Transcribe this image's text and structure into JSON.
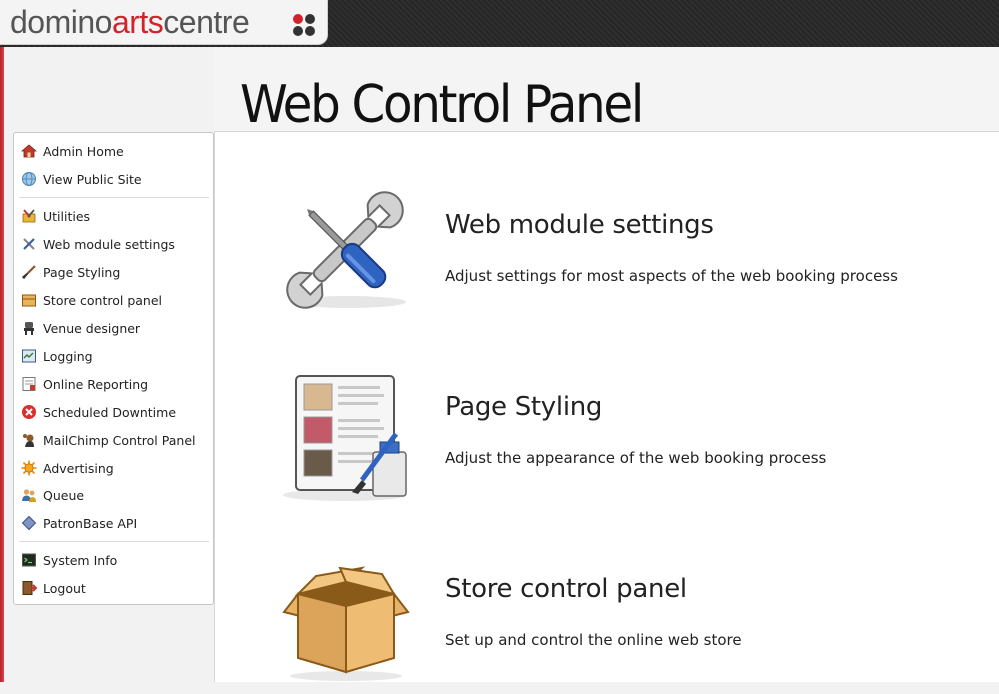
{
  "brand": {
    "part1": "domino",
    "part2": "arts",
    "part3": "centre"
  },
  "page": {
    "title": "Web Control Panel"
  },
  "sidebar": {
    "group1": [
      {
        "label": "Admin Home",
        "icon": "home-icon"
      },
      {
        "label": "View Public Site",
        "icon": "globe-icon"
      }
    ],
    "group2": [
      {
        "label": "Utilities",
        "icon": "utilities-icon"
      },
      {
        "label": "Web module settings",
        "icon": "tools-icon"
      },
      {
        "label": "Page Styling",
        "icon": "paintbrush-icon"
      },
      {
        "label": "Store control panel",
        "icon": "box-icon"
      },
      {
        "label": "Venue designer",
        "icon": "seat-icon"
      },
      {
        "label": "Logging",
        "icon": "log-icon"
      },
      {
        "label": "Online Reporting",
        "icon": "report-icon"
      },
      {
        "label": "Scheduled Downtime",
        "icon": "stop-icon"
      },
      {
        "label": "MailChimp Control Panel",
        "icon": "mailchimp-icon"
      },
      {
        "label": "Advertising",
        "icon": "sun-icon"
      },
      {
        "label": "Queue",
        "icon": "people-icon"
      },
      {
        "label": "PatronBase API",
        "icon": "diamond-icon"
      }
    ],
    "group3": [
      {
        "label": "System Info",
        "icon": "terminal-icon"
      },
      {
        "label": "Logout",
        "icon": "logout-icon"
      }
    ]
  },
  "sections": [
    {
      "title": "Web module settings",
      "description": "Adjust settings for most aspects of the web booking process",
      "icon": "wrench-screwdriver-icon"
    },
    {
      "title": "Page Styling",
      "description": "Adjust the appearance of the web booking process",
      "icon": "page-styling-icon"
    },
    {
      "title": "Store control panel",
      "description": "Set up and control the online web store",
      "icon": "open-box-icon"
    }
  ],
  "colors": {
    "brand_red": "#d2232a",
    "brand_grey": "#555555",
    "topbar": "#2a2a2a"
  }
}
